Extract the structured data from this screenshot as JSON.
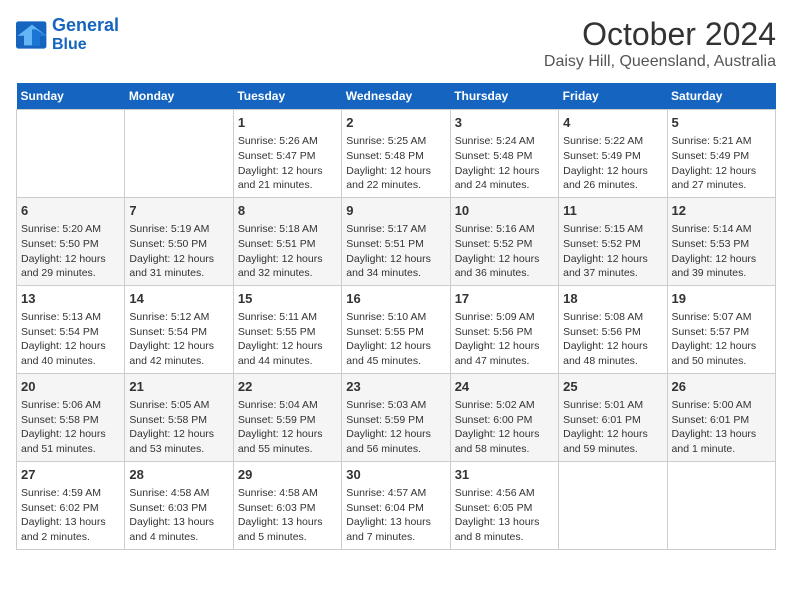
{
  "logo": {
    "line1": "General",
    "line2": "Blue"
  },
  "title": "October 2024",
  "subtitle": "Daisy Hill, Queensland, Australia",
  "weekdays": [
    "Sunday",
    "Monday",
    "Tuesday",
    "Wednesday",
    "Thursday",
    "Friday",
    "Saturday"
  ],
  "weeks": [
    [
      {
        "day": null,
        "info": null
      },
      {
        "day": null,
        "info": null
      },
      {
        "day": "1",
        "info": "Sunrise: 5:26 AM\nSunset: 5:47 PM\nDaylight: 12 hours and 21 minutes."
      },
      {
        "day": "2",
        "info": "Sunrise: 5:25 AM\nSunset: 5:48 PM\nDaylight: 12 hours and 22 minutes."
      },
      {
        "day": "3",
        "info": "Sunrise: 5:24 AM\nSunset: 5:48 PM\nDaylight: 12 hours and 24 minutes."
      },
      {
        "day": "4",
        "info": "Sunrise: 5:22 AM\nSunset: 5:49 PM\nDaylight: 12 hours and 26 minutes."
      },
      {
        "day": "5",
        "info": "Sunrise: 5:21 AM\nSunset: 5:49 PM\nDaylight: 12 hours and 27 minutes."
      }
    ],
    [
      {
        "day": "6",
        "info": "Sunrise: 5:20 AM\nSunset: 5:50 PM\nDaylight: 12 hours and 29 minutes."
      },
      {
        "day": "7",
        "info": "Sunrise: 5:19 AM\nSunset: 5:50 PM\nDaylight: 12 hours and 31 minutes."
      },
      {
        "day": "8",
        "info": "Sunrise: 5:18 AM\nSunset: 5:51 PM\nDaylight: 12 hours and 32 minutes."
      },
      {
        "day": "9",
        "info": "Sunrise: 5:17 AM\nSunset: 5:51 PM\nDaylight: 12 hours and 34 minutes."
      },
      {
        "day": "10",
        "info": "Sunrise: 5:16 AM\nSunset: 5:52 PM\nDaylight: 12 hours and 36 minutes."
      },
      {
        "day": "11",
        "info": "Sunrise: 5:15 AM\nSunset: 5:52 PM\nDaylight: 12 hours and 37 minutes."
      },
      {
        "day": "12",
        "info": "Sunrise: 5:14 AM\nSunset: 5:53 PM\nDaylight: 12 hours and 39 minutes."
      }
    ],
    [
      {
        "day": "13",
        "info": "Sunrise: 5:13 AM\nSunset: 5:54 PM\nDaylight: 12 hours and 40 minutes."
      },
      {
        "day": "14",
        "info": "Sunrise: 5:12 AM\nSunset: 5:54 PM\nDaylight: 12 hours and 42 minutes."
      },
      {
        "day": "15",
        "info": "Sunrise: 5:11 AM\nSunset: 5:55 PM\nDaylight: 12 hours and 44 minutes."
      },
      {
        "day": "16",
        "info": "Sunrise: 5:10 AM\nSunset: 5:55 PM\nDaylight: 12 hours and 45 minutes."
      },
      {
        "day": "17",
        "info": "Sunrise: 5:09 AM\nSunset: 5:56 PM\nDaylight: 12 hours and 47 minutes."
      },
      {
        "day": "18",
        "info": "Sunrise: 5:08 AM\nSunset: 5:56 PM\nDaylight: 12 hours and 48 minutes."
      },
      {
        "day": "19",
        "info": "Sunrise: 5:07 AM\nSunset: 5:57 PM\nDaylight: 12 hours and 50 minutes."
      }
    ],
    [
      {
        "day": "20",
        "info": "Sunrise: 5:06 AM\nSunset: 5:58 PM\nDaylight: 12 hours and 51 minutes."
      },
      {
        "day": "21",
        "info": "Sunrise: 5:05 AM\nSunset: 5:58 PM\nDaylight: 12 hours and 53 minutes."
      },
      {
        "day": "22",
        "info": "Sunrise: 5:04 AM\nSunset: 5:59 PM\nDaylight: 12 hours and 55 minutes."
      },
      {
        "day": "23",
        "info": "Sunrise: 5:03 AM\nSunset: 5:59 PM\nDaylight: 12 hours and 56 minutes."
      },
      {
        "day": "24",
        "info": "Sunrise: 5:02 AM\nSunset: 6:00 PM\nDaylight: 12 hours and 58 minutes."
      },
      {
        "day": "25",
        "info": "Sunrise: 5:01 AM\nSunset: 6:01 PM\nDaylight: 12 hours and 59 minutes."
      },
      {
        "day": "26",
        "info": "Sunrise: 5:00 AM\nSunset: 6:01 PM\nDaylight: 13 hours and 1 minute."
      }
    ],
    [
      {
        "day": "27",
        "info": "Sunrise: 4:59 AM\nSunset: 6:02 PM\nDaylight: 13 hours and 2 minutes."
      },
      {
        "day": "28",
        "info": "Sunrise: 4:58 AM\nSunset: 6:03 PM\nDaylight: 13 hours and 4 minutes."
      },
      {
        "day": "29",
        "info": "Sunrise: 4:58 AM\nSunset: 6:03 PM\nDaylight: 13 hours and 5 minutes."
      },
      {
        "day": "30",
        "info": "Sunrise: 4:57 AM\nSunset: 6:04 PM\nDaylight: 13 hours and 7 minutes."
      },
      {
        "day": "31",
        "info": "Sunrise: 4:56 AM\nSunset: 6:05 PM\nDaylight: 13 hours and 8 minutes."
      },
      {
        "day": null,
        "info": null
      },
      {
        "day": null,
        "info": null
      }
    ]
  ]
}
